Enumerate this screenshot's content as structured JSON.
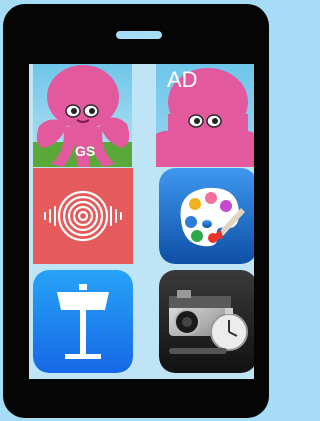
{
  "apps": [
    {
      "id": "octo-gs",
      "badge": "GS",
      "icon": "octopus-icon"
    },
    {
      "id": "octo-ad",
      "badge": "AD",
      "icon": "octopus-icon"
    },
    {
      "id": "sound",
      "icon": "sound-wave-icon"
    },
    {
      "id": "paint",
      "icon": "palette-icon"
    },
    {
      "id": "keynote",
      "icon": "podium-icon"
    },
    {
      "id": "camera",
      "icon": "camera-icon"
    }
  ],
  "colors": {
    "background": "#a6dcf6",
    "phone": "#050505",
    "octopus": "#e2599e",
    "sound_tile": "#e55a5a",
    "paint_tile": "#1b6cc8",
    "keynote_tile": "#1e89f3"
  }
}
